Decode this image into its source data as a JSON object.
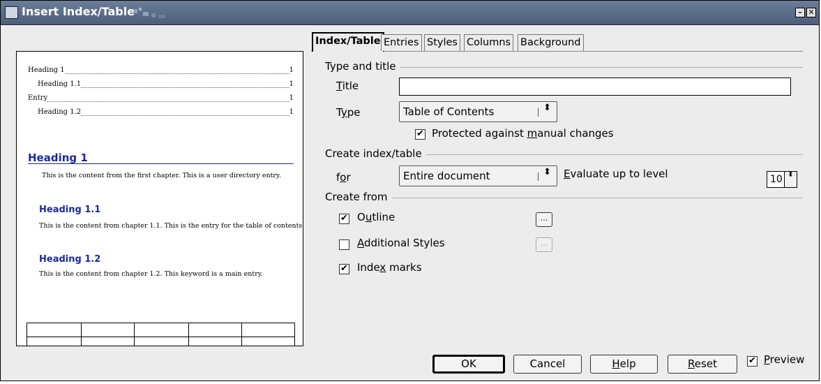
{
  "window": {
    "title": "Insert Index/Table",
    "minimize_glyph": "–",
    "close_glyph": "✕",
    "colors": {
      "titlebar": "#5a6b88",
      "heading": "#1c2a9c"
    }
  },
  "tabs": [
    {
      "label": "Index/Table",
      "active": true
    },
    {
      "label": "Entries"
    },
    {
      "label": "Styles"
    },
    {
      "label": "Columns"
    },
    {
      "label": "Background"
    }
  ],
  "preview": {
    "toc": [
      {
        "text": "Heading 1",
        "page": "1"
      },
      {
        "text": "Heading 1.1",
        "page": "1"
      },
      {
        "text": "Entry",
        "page": "1"
      },
      {
        "text": "Heading 1.2",
        "page": "1"
      }
    ],
    "heading1": "Heading 1",
    "body1": "This is the content from the first chapter. This is a user directory entry.",
    "heading11": "Heading 1.1",
    "body11": "This is the content from chapter 1.1. This is the entry for the table of contents.",
    "heading12": "Heading 1.2",
    "body12": "This is the content from chapter 1.2. This keyword is a main entry."
  },
  "type_and_title": {
    "section_label": "Type and title",
    "title_label_u": "T",
    "title_label_rest": "itle",
    "title_value": "",
    "type_label_pre": "T",
    "type_label_u": "y",
    "type_label_rest": "pe",
    "type_value": "Table of Contents",
    "protected_pre": "Protected against ",
    "protected_u": "m",
    "protected_rest": "anual changes",
    "protected_checked": true
  },
  "create_index": {
    "section_label": "Create index/table",
    "for_label_pre": "f",
    "for_label_u": "o",
    "for_label_rest": "r",
    "for_value": "Entire document",
    "evaluate_u": "E",
    "evaluate_rest": "valuate up to level",
    "level_value": "10"
  },
  "create_from": {
    "section_label": "Create from",
    "outline_pre": "O",
    "outline_u": "u",
    "outline_rest": "tline",
    "outline_checked": true,
    "additional_u": "A",
    "additional_rest": "dditional Styles",
    "additional_checked": false,
    "index_pre": "Inde",
    "index_u": "x",
    "index_rest": " marks",
    "index_checked": true,
    "dots_label": "..."
  },
  "buttons": {
    "ok": "OK",
    "cancel": "Cancel",
    "help_u": "H",
    "help_rest": "elp",
    "reset_u": "R",
    "reset_rest": "eset",
    "preview_u": "P",
    "preview_rest": "review",
    "preview_checked": true
  },
  "glyphs": {
    "check": "✔",
    "updown": "⬍"
  }
}
